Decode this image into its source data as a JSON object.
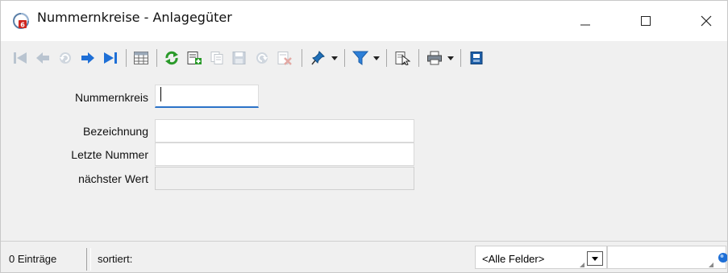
{
  "window": {
    "title": "Nummernkreise - Anlagegüter",
    "controls": {
      "minimize": "minimize",
      "maximize": "maximize",
      "close": "close"
    }
  },
  "toolbar": {
    "buttons": [
      {
        "icon": "first-record-icon",
        "enabled": false
      },
      {
        "icon": "previous-record-icon",
        "enabled": false
      },
      {
        "icon": "undo-icon",
        "enabled": false
      },
      {
        "icon": "next-record-icon",
        "enabled": true
      },
      {
        "icon": "last-record-icon",
        "enabled": true
      },
      {
        "icon": "table-view-icon",
        "enabled": true
      },
      {
        "icon": "refresh-icon",
        "enabled": true
      },
      {
        "icon": "new-record-icon",
        "enabled": true
      },
      {
        "icon": "copy-record-icon",
        "enabled": false
      },
      {
        "icon": "save-icon",
        "enabled": false
      },
      {
        "icon": "revert-icon",
        "enabled": false
      },
      {
        "icon": "delete-icon",
        "enabled": false
      },
      {
        "icon": "pin-icon",
        "enabled": true
      },
      {
        "icon": "filter-icon",
        "enabled": true
      },
      {
        "icon": "document-cursor-icon",
        "enabled": true
      },
      {
        "icon": "print-icon",
        "enabled": true
      },
      {
        "icon": "clipboard-icon",
        "enabled": true
      }
    ]
  },
  "form": {
    "nummernkreis": {
      "label": "Nummernkreis",
      "value": ""
    },
    "bezeichnung": {
      "label": "Bezeichnung",
      "value": ""
    },
    "letzte_nummer": {
      "label": "Letzte Nummer",
      "value": ""
    },
    "naechster_wert": {
      "label": "nächster Wert",
      "value": ""
    }
  },
  "status": {
    "count": "0 Einträge",
    "sorted": "sortiert:",
    "field_filter": "<Alle Felder>",
    "search_value": ""
  },
  "colors": {
    "accent_blue": "#1e6fd6",
    "refresh_green": "#2a9a2a",
    "filter_blue": "#2d7fd8",
    "disabled_gray": "#b9c4d0"
  }
}
